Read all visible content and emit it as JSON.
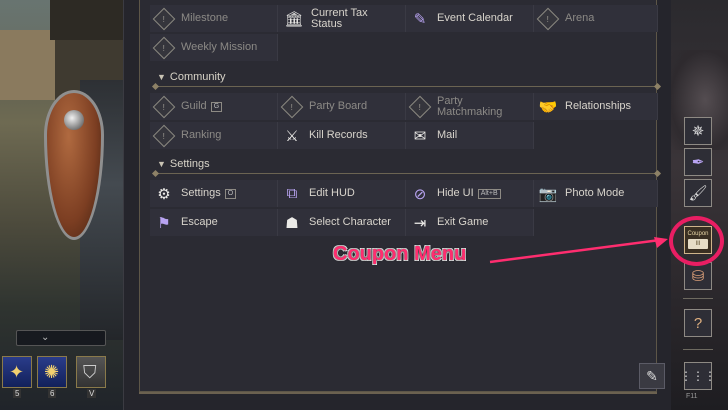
{
  "game_view": {
    "hotbar_slots": [
      {
        "number": "5"
      },
      {
        "number": "6"
      },
      {
        "number": "V"
      }
    ]
  },
  "menu": {
    "top_rows": [
      {
        "label": "Milestone",
        "enabled": false
      },
      {
        "label": "Current Tax Status",
        "enabled": true
      },
      {
        "label": "Event Calendar",
        "enabled": true
      },
      {
        "label": "Arena",
        "enabled": false
      },
      {
        "label": "Weekly Mission",
        "enabled": false
      }
    ],
    "community": {
      "header": "Community",
      "items": [
        {
          "label": "Guild",
          "key": "G",
          "enabled": false
        },
        {
          "label": "Party Board",
          "enabled": false
        },
        {
          "label": "Party Matchmaking",
          "enabled": false
        },
        {
          "label": "Relationships",
          "enabled": true
        },
        {
          "label": "Ranking",
          "enabled": false
        },
        {
          "label": "Kill Records",
          "enabled": true
        },
        {
          "label": "Mail",
          "enabled": true
        }
      ]
    },
    "settings": {
      "header": "Settings",
      "items": [
        {
          "label": "Settings",
          "key": "O",
          "enabled": true
        },
        {
          "label": "Edit HUD",
          "enabled": true
        },
        {
          "label": "Hide UI",
          "key": "Alt+B",
          "enabled": true
        },
        {
          "label": "Photo Mode",
          "enabled": true
        },
        {
          "label": "Escape",
          "enabled": true
        },
        {
          "label": "Select Character",
          "enabled": true
        },
        {
          "label": "Exit Game",
          "enabled": true
        }
      ]
    }
  },
  "sidebar": {
    "coupon_caption": "Coupon",
    "grid_caption": "F11"
  },
  "annotation": {
    "text": "Coupon Menu",
    "color": "#ff2d6f",
    "ring_color": "#e91e63"
  },
  "icons": {
    "locked": "lock-diamond-icon",
    "tax": "tax-building-icon",
    "calendar": "calendar-icon",
    "relationships": "handshake-icon",
    "kill_records": "crossed-swords-icon",
    "mail": "envelope-icon",
    "settings": "gear-icon",
    "edit_hud": "edit-layout-icon",
    "hide_ui": "eye-hidden-icon",
    "photo": "camera-icon",
    "escape": "flag-icon",
    "select_character": "character-bust-icon",
    "exit": "exit-door-icon",
    "coupon": "coupon-ticket-icon"
  }
}
